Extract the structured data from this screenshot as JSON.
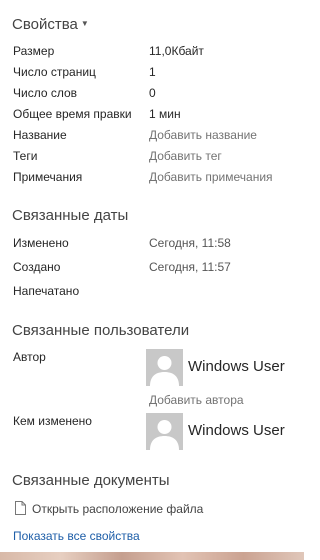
{
  "properties": {
    "title": "Свойства",
    "rows": [
      {
        "key": "Размер",
        "value": "11,0Кбайт"
      },
      {
        "key": "Число страниц",
        "value": "1"
      },
      {
        "key": "Число слов",
        "value": "0"
      },
      {
        "key": "Общее время правки",
        "value": "1 мин"
      },
      {
        "key": "Название",
        "value": "Добавить название"
      },
      {
        "key": "Теги",
        "value": "Добавить тег"
      },
      {
        "key": "Примечания",
        "value": "Добавить примечания"
      }
    ]
  },
  "dates": {
    "title": "Связанные даты",
    "rows": [
      {
        "key": "Изменено",
        "value": "Сегодня, 11:58"
      },
      {
        "key": "Создано",
        "value": "Сегодня, 11:57"
      },
      {
        "key": "Напечатано",
        "value": ""
      }
    ]
  },
  "people": {
    "title": "Связанные пользователи",
    "author_label": "Автор",
    "author_name": "Windows User",
    "add_author": "Добавить автора",
    "modified_by_label": "Кем изменено",
    "modified_by_name": "Windows User"
  },
  "documents": {
    "title": "Связанные документы",
    "open_location": "Открыть расположение файла"
  },
  "footer": {
    "show_all": "Показать все свойства"
  },
  "colors": {
    "link": "#1e5ea8",
    "placeholder": "#737373",
    "avatar_bg": "#c8c8c8"
  }
}
